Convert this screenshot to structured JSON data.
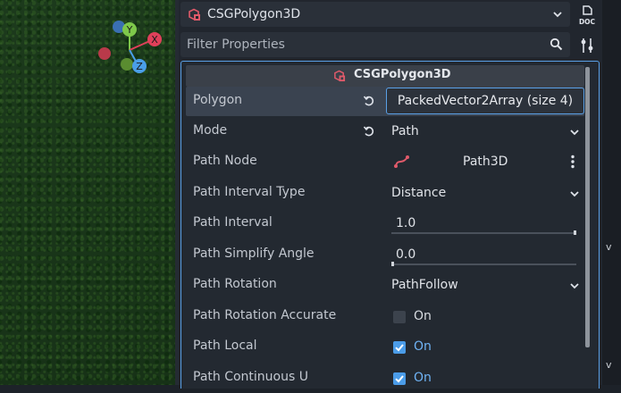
{
  "header": {
    "object_name": "CSGPolygon3D",
    "doc_label": "DOC"
  },
  "filter": {
    "placeholder": "Filter Properties"
  },
  "gizmo": {
    "y_label": "Y",
    "x_label": "X",
    "z_label": "Z"
  },
  "section": {
    "title": "CSGPolygon3D"
  },
  "properties": [
    {
      "name": "Polygon",
      "value": "PackedVector2Array (size 4)"
    },
    {
      "name": "Mode",
      "value": "Path"
    },
    {
      "name": "Path Node",
      "value": "Path3D"
    },
    {
      "name": "Path Interval Type",
      "value": "Distance"
    },
    {
      "name": "Path Interval",
      "value": "1.0"
    },
    {
      "name": "Path Simplify Angle",
      "value": "0.0"
    },
    {
      "name": "Path Rotation",
      "value": "PathFollow"
    },
    {
      "name": "Path Rotation Accurate",
      "value": "On",
      "checked": false
    },
    {
      "name": "Path Local",
      "value": "On",
      "checked": true
    },
    {
      "name": "Path Continuous U",
      "value": "On",
      "checked": true
    }
  ],
  "right_strip": {
    "char_top": "v",
    "char_bottom": "v"
  },
  "colors": {
    "accent": "#5aa0e6",
    "csg_icon": "#e05a6a",
    "gizmo_x": "#e0405a",
    "gizmo_y": "#7ec84a",
    "gizmo_z": "#4a9ee8"
  }
}
